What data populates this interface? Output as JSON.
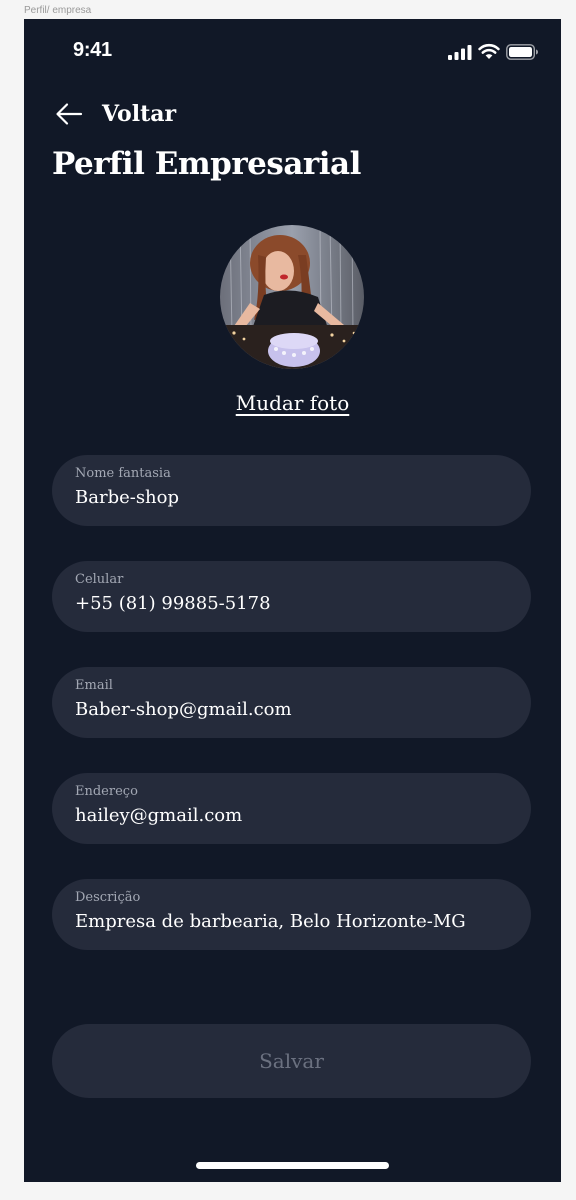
{
  "frame": {
    "label": "Perfil/ empresa"
  },
  "status_bar": {
    "time": "9:41",
    "icons": [
      "cellular-signal-icon",
      "wifi-icon",
      "battery-icon"
    ]
  },
  "header": {
    "back_icon": "arrow-left-icon",
    "back_label": "Voltar",
    "title": "Perfil Empresarial"
  },
  "profile": {
    "change_photo_label": "Mudar foto"
  },
  "form": {
    "fields": [
      {
        "label": "Nome fantasia",
        "value": "Barbe-shop"
      },
      {
        "label": "Celular",
        "value": "+55 (81) 99885-5178"
      },
      {
        "label": "Email",
        "value": "Baber-shop@gmail.com"
      },
      {
        "label": "Endereço",
        "value": "hailey@gmail.com"
      },
      {
        "label": "Descrição",
        "value": "Empresa de barbearia, Belo Horizonte-MG"
      }
    ],
    "save_label": "Salvar"
  },
  "colors": {
    "background": "#111827",
    "field_background": "#252b3b",
    "text_primary": "#ffffff",
    "text_label": "#a3a8b4",
    "button_disabled_text": "#6b7180"
  }
}
